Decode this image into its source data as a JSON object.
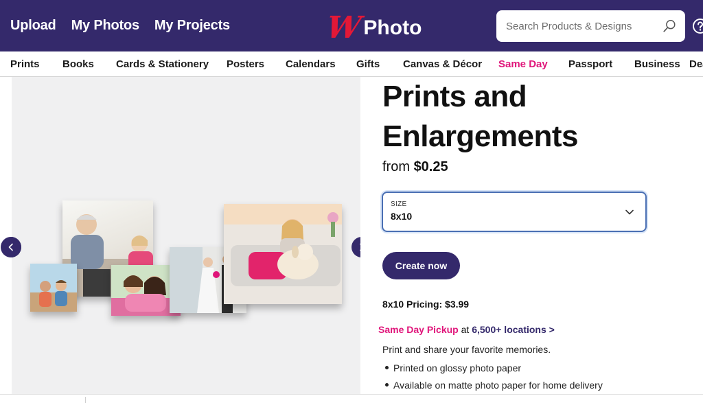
{
  "header": {
    "nav": [
      "Upload",
      "My Photos",
      "My Projects"
    ],
    "logo_mark": "W",
    "logo_text": "Photo",
    "search_placeholder": "Search Products & Designs"
  },
  "categories": [
    {
      "label": "Prints",
      "highlight": false
    },
    {
      "label": "Books",
      "highlight": false
    },
    {
      "label": "Cards & Stationery",
      "highlight": false
    },
    {
      "label": "Posters",
      "highlight": false
    },
    {
      "label": "Calendars",
      "highlight": false
    },
    {
      "label": "Gifts",
      "highlight": false
    },
    {
      "label": "Canvas & Décor",
      "highlight": false
    },
    {
      "label": "Same Day",
      "highlight": true
    },
    {
      "label": "Passport",
      "highlight": false
    },
    {
      "label": "Business",
      "highlight": false
    },
    {
      "label": "Deals",
      "highlight": false
    }
  ],
  "product": {
    "title_line1": "Prints and",
    "title_line2": "Enlargements",
    "price_prefix": "from ",
    "price_value": "$0.25",
    "size_label": "SIZE",
    "size_value": "8x10",
    "cta_label": "Create now",
    "pricing_text": "8x10 Pricing: $3.99",
    "pickup_label": "Same Day Pickup",
    "pickup_at": " at ",
    "pickup_link": "6,500+ locations >",
    "description": "Print and share your favorite memories.",
    "bullets": [
      "Printed on glossy photo paper",
      "Available on matte photo paper for home delivery"
    ]
  },
  "colors": {
    "brand_purple": "#34296b",
    "brand_red": "#e31837",
    "accent_pink": "#e0157a"
  }
}
